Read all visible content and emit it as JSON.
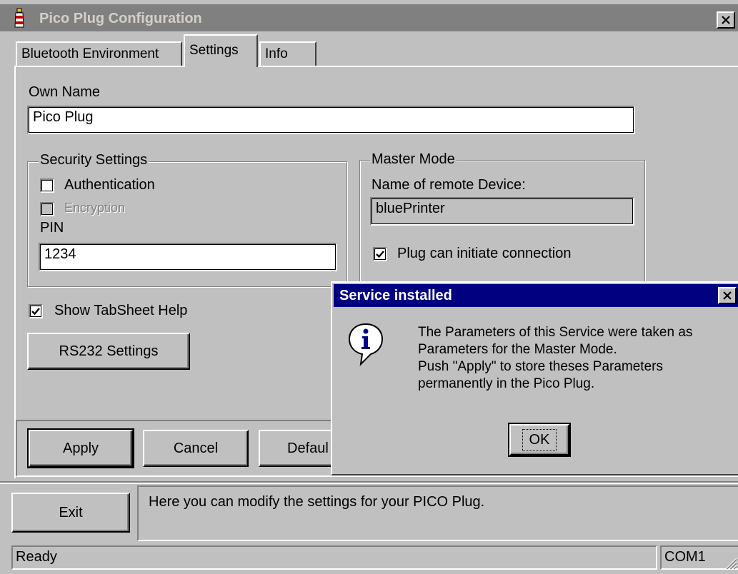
{
  "window": {
    "title": "Pico Plug Configuration"
  },
  "tabs": [
    {
      "label": "Bluetooth Environment"
    },
    {
      "label": "Settings"
    },
    {
      "label": "Info"
    }
  ],
  "settings": {
    "own_name_label": "Own Name",
    "own_name_value": "Pico Plug",
    "security": {
      "group_label": "Security Settings",
      "authentication_label": "Authentication",
      "authentication_checked": false,
      "encryption_label": "Encryption",
      "encryption_checked": false,
      "pin_label": "PIN",
      "pin_value": "1234"
    },
    "master": {
      "group_label": "Master Mode",
      "remote_label": "Name of remote Device:",
      "remote_value": "bluePrinter",
      "initiate_label": "Plug can initiate connection",
      "initiate_checked": true
    },
    "show_help_label": "Show TabSheet Help",
    "show_help_checked": true,
    "rs232_button": "RS232 Settings"
  },
  "actions": {
    "apply": "Apply",
    "cancel": "Cancel",
    "default": "Defaul"
  },
  "footer": {
    "exit": "Exit",
    "help_text": "Here you can modify the settings for your PICO Plug."
  },
  "statusbar": {
    "status": "Ready",
    "port": "COM1"
  },
  "dialog": {
    "title": "Service installed",
    "message_lines": [
      "The Parameters of this Service were taken as",
      "Parameters for the Master Mode.",
      "Push \"Apply\" to store theses Parameters",
      "permanently in the Pico Plug."
    ],
    "ok": "OK"
  },
  "icons": {
    "app": "lighthouse-icon",
    "info": "info-icon",
    "close": "close-icon"
  },
  "colors": {
    "titlebar_inactive": "#808080",
    "titlebar_active": "#000080",
    "face": "#c0c0c0"
  }
}
